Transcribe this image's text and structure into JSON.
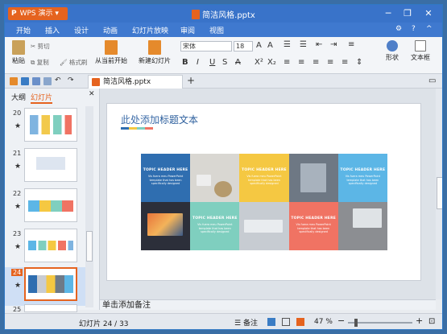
{
  "window": {
    "app_button": "WPS 演示",
    "title": "简洁风格.pptx"
  },
  "menu": [
    "开始",
    "插入",
    "设计",
    "动画",
    "幻灯片放映",
    "审阅",
    "视图"
  ],
  "ribbon": {
    "paste": "粘贴",
    "cut": "剪切",
    "copy": "复制",
    "format_painter": "格式刷",
    "from_current": "从当前开始",
    "new_slide": "新建幻灯片",
    "font_name": "宋体",
    "font_size": "18",
    "shape": "形状",
    "textbox": "文本框"
  },
  "doc_tab": "简洁风格.pptx",
  "panel": {
    "tab_outline": "大纲",
    "tab_slides": "幻灯片"
  },
  "thumbnails": [
    {
      "num": "20"
    },
    {
      "num": "21"
    },
    {
      "num": "22"
    },
    {
      "num": "23"
    },
    {
      "num": "24"
    },
    {
      "num": "25"
    }
  ],
  "slide": {
    "title_a": "此处添加",
    "title_b": "标题文本",
    "cells": [
      {
        "header": "TOPIC HEADER HERE",
        "body": "Vis fuera meu PowerPoint template that has been specifically designed"
      },
      {
        "header": "TOPIC HEADER HERE",
        "body": "Vis fuera meu PowerPoint template that has been specifically designed"
      },
      {
        "header": "TOPIC HEADER HERE",
        "body": "Vis fuera meu PowerPoint template that has been specifically designed"
      },
      {
        "header": "TOPIC HEADER HERE",
        "body": "Vis fuera meu PowerPoint template that has been specifically designed"
      },
      {
        "header": "TOPIC HEADER HERE",
        "body": "Vis fuera meu PowerPoint template that has been specifically designed"
      }
    ]
  },
  "notes": "单击添加备注",
  "status": {
    "slide_count": "幻灯片 24 / 33",
    "notes_btn": "备注",
    "zoom": "47 %"
  },
  "colors": {
    "blue": "#2f6eb0",
    "yellow": "#f5c842",
    "skyblue": "#5cb6e6",
    "mint": "#7fcfbf",
    "coral": "#f07363",
    "orange": "#e5631f"
  }
}
